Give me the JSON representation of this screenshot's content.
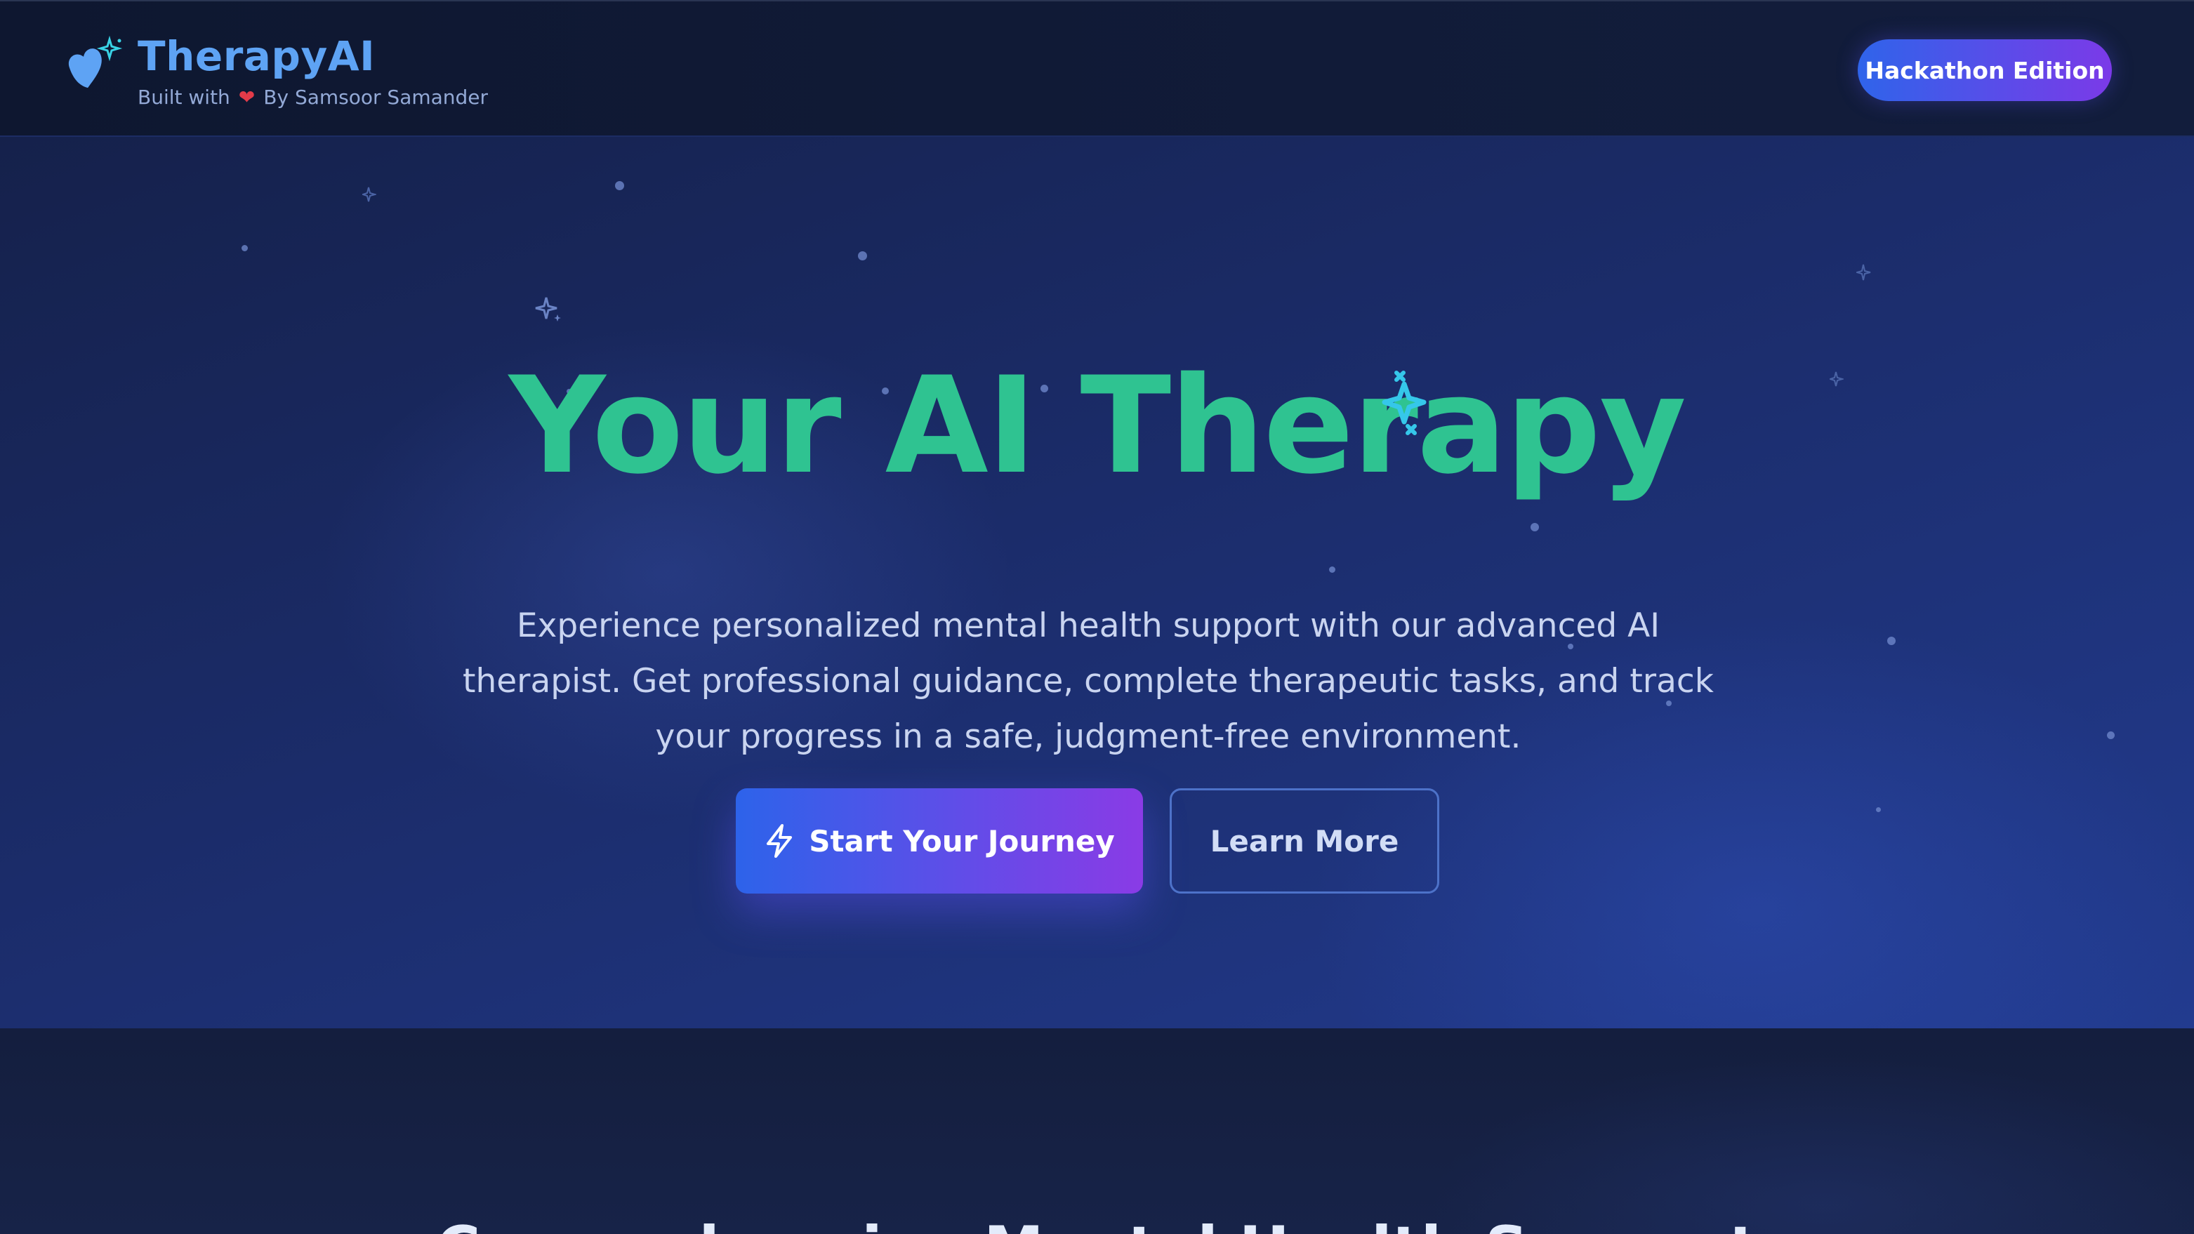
{
  "header": {
    "brand_title": "TherapyAI",
    "brand_built_with": "Built with",
    "brand_author": "By Samsoor Samander",
    "badge_label": "Hackathon Edition"
  },
  "hero": {
    "title": "Your AI Therapy",
    "description": "Experience personalized mental health support with our advanced AI therapist. Get professional guidance, complete therapeutic tasks, and track your progress in a safe, judgment-free environment.",
    "primary_button": "Start Your Journey",
    "secondary_button": "Learn More"
  },
  "features": {
    "title": "Comprehensive Mental Health Support"
  },
  "colors": {
    "accent_green": "#2fc391",
    "brand_blue": "#5ea3f4",
    "gradient_start": "#2d63ea",
    "gradient_end": "#8a3be6",
    "heart": "#e23b49"
  },
  "icons": {
    "logo": "heart-sparkle-icon",
    "author_heart": "heart-icon",
    "primary_button_icon": "lightning-bolt-icon",
    "title_accent": "sparkle-icon"
  }
}
